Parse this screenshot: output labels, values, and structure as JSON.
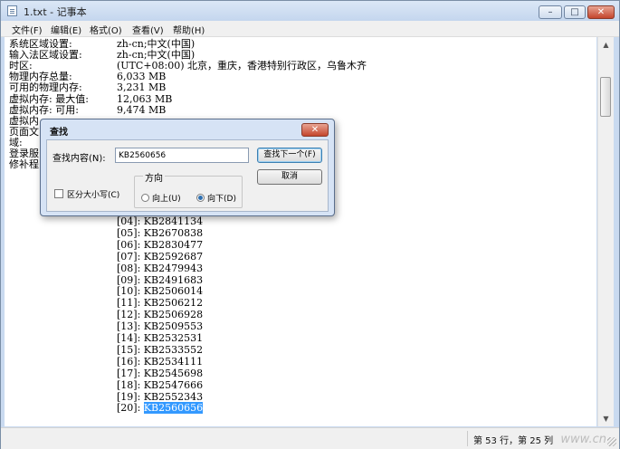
{
  "window": {
    "title": "1.txt - 记事本",
    "minimize": "–",
    "maximize": "□",
    "close": "✕"
  },
  "menu": [
    "文件(F)",
    "编辑(E)",
    "格式(O)",
    "查看(V)",
    "帮助(H)"
  ],
  "lines": [
    {
      "label": "系统区域设置:",
      "value": "zh-cn;中文(中国)"
    },
    {
      "label": "输入法区域设置:",
      "value": "zh-cn;中文(中国)"
    },
    {
      "label": "时区:",
      "value": "(UTC+08:00) 北京，重庆，香港特别行政区，乌鲁木齐"
    },
    {
      "label": "物理内存总量:",
      "value": "6,033 MB"
    },
    {
      "label": "可用的物理内存:",
      "value": "3,231 MB"
    },
    {
      "label": "虚拟内存: 最大值:",
      "value": "12,063 MB"
    },
    {
      "label": "虚拟内存: 可用:",
      "value": "9,474 MB"
    },
    {
      "label": "虚拟内",
      "value": ""
    },
    {
      "label": "页面文",
      "value": ""
    },
    {
      "label": "域:",
      "value": ""
    },
    {
      "label": "登录服",
      "value": ""
    },
    {
      "label": "修补程",
      "value": ""
    }
  ],
  "hotfixes": [
    "[04]: KB2841134",
    "[05]: KB2670838",
    "[06]: KB2830477",
    "[07]: KB2592687",
    "[08]: KB2479943",
    "[09]: KB2491683",
    "[10]: KB2506014",
    "[11]: KB2506212",
    "[12]: KB2506928",
    "[13]: KB2509553",
    "[14]: KB2532531",
    "[15]: KB2533552",
    "[16]: KB2534111",
    "[17]: KB2545698",
    "[18]: KB2547666",
    "[19]: KB2552343"
  ],
  "last_line": {
    "prefix": "[20]: ",
    "selected": "KB2560656"
  },
  "status": {
    "position": "第 53 行，第 25 列"
  },
  "watermark": "www.cn",
  "find_dialog": {
    "title": "查找",
    "close": "✕",
    "label": "查找内容(N):",
    "value": "KB2560656",
    "find_next": "查找下一个(F)",
    "cancel": "取消",
    "direction_title": "方向",
    "up": "向上(U)",
    "down": "向下(D)",
    "match_case": "区分大小写(C)"
  },
  "scroll_up": "▲",
  "scroll_down": "▼"
}
